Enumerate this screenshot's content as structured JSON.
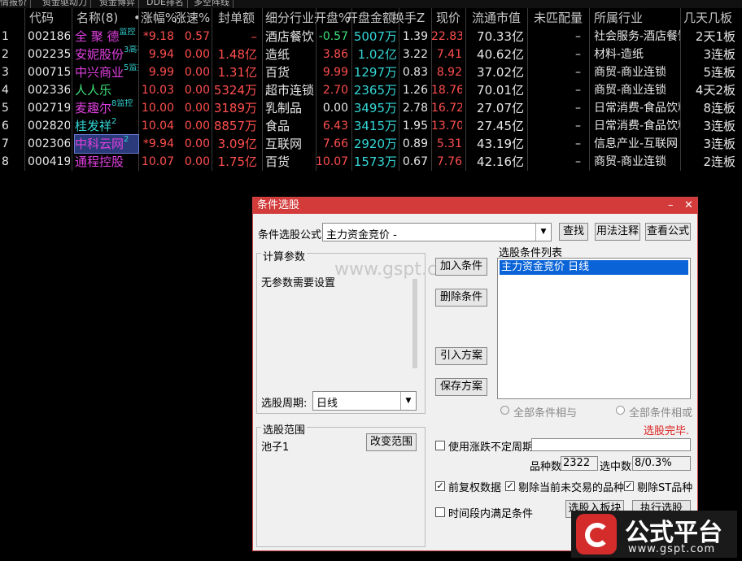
{
  "top_tabs": [
    "情报价",
    "资金驱动力",
    "资金博弈",
    "DDE排名",
    "多空阵线"
  ],
  "columns": [
    "代码",
    "名称(8)",
    "•涨幅%",
    "涨速%",
    "封单额",
    "细分行业",
    "开盘%",
    "开盘金额",
    "换手Z",
    "现价",
    "流通市值",
    "未匹配量",
    "所属行业",
    "几天几板"
  ],
  "rows": [
    {
      "idx": "1",
      "code": "002186",
      "name": "全 聚 德",
      "tag": "监控",
      "pct": "*9.18",
      "speed": "0.57",
      "seal": "–",
      "subind": "酒店餐饮",
      "open_pct": "-0.57",
      "open_amt": "5007万",
      "turnover": "1.39",
      "price": "22.83",
      "mcap": "70.33亿",
      "unmatched": "–",
      "industry": "社会服务-酒店餐饮",
      "boards": "2天1板"
    },
    {
      "idx": "2",
      "code": "002235",
      "name": "安妮股份",
      "tag": "3高视",
      "pct": "9.94",
      "speed": "0.00",
      "seal": "1.48亿",
      "subind": "造纸",
      "open_pct": "3.86",
      "open_amt": "1.02亿",
      "turnover": "3.22",
      "price": "7.41",
      "mcap": "40.62亿",
      "unmatched": "–",
      "industry": "材料-造纸",
      "boards": "3连板"
    },
    {
      "idx": "3",
      "code": "000715",
      "name": "中兴商业",
      "tag": "5监控",
      "pct": "9.99",
      "speed": "0.00",
      "seal": "1.31亿",
      "subind": "百货",
      "open_pct": "9.99",
      "open_amt": "1297万",
      "turnover": "0.83",
      "price": "8.92",
      "mcap": "37.02亿",
      "unmatched": "–",
      "industry": "商贸-商业连锁",
      "boards": "5连板"
    },
    {
      "idx": "4",
      "code": "002336",
      "name": "人人乐",
      "tag": "",
      "pct": "10.03",
      "speed": "0.00",
      "seal": "5324万",
      "subind": "超市连锁",
      "open_pct": "2.70",
      "open_amt": "2365万",
      "turnover": "1.26",
      "price": "18.76",
      "mcap": "70.01亿",
      "unmatched": "–",
      "industry": "商贸-商业连锁",
      "boards": "4天2板"
    },
    {
      "idx": "5",
      "code": "002719",
      "name": "麦趣尔",
      "tag": "8监控",
      "pct": "10.00",
      "speed": "0.00",
      "seal": "3189万",
      "subind": "乳制品",
      "open_pct": "0.00",
      "open_amt": "3495万",
      "turnover": "2.78",
      "price": "16.72",
      "mcap": "27.07亿",
      "unmatched": "–",
      "industry": "日常消费-食品饮料",
      "boards": "8连板"
    },
    {
      "idx": "6",
      "code": "002820",
      "name": "桂发祥",
      "tag": "2",
      "pct": "10.04",
      "speed": "0.00",
      "seal": "8857万",
      "subind": "食品",
      "open_pct": "6.43",
      "open_amt": "3415万",
      "turnover": "1.95",
      "price": "13.70",
      "mcap": "27.45亿",
      "unmatched": "–",
      "industry": "日常消费-食品饮料",
      "boards": "3连板"
    },
    {
      "idx": "7",
      "code": "002306",
      "name": "中科云网",
      "tag": "2",
      "pct": "*9.94",
      "speed": "0.00",
      "seal": "3.09亿",
      "subind": "互联网",
      "open_pct": "7.66",
      "open_amt": "2920万",
      "turnover": "0.89",
      "price": "5.31",
      "mcap": "43.19亿",
      "unmatched": "–",
      "industry": "信息产业-互联网",
      "boards": "3连板"
    },
    {
      "idx": "8",
      "code": "000419",
      "name": "通程控股",
      "tag": "",
      "pct": "10.07",
      "speed": "0.00",
      "seal": "1.75亿",
      "subind": "百货",
      "open_pct": "10.07",
      "open_amt": "1573万",
      "turnover": "0.67",
      "price": "7.76",
      "mcap": "42.16亿",
      "unmatched": "–",
      "industry": "商贸-商业连锁",
      "boards": "2连板"
    }
  ],
  "dialog": {
    "title": "条件选股",
    "formula_label": "条件选股公式",
    "formula_value": "主力资金竞价 -",
    "btn_find": "查找",
    "btn_usage": "用法注释",
    "btn_view": "查看公式",
    "params_title": "计算参数",
    "params_text": "无参数需要设置",
    "watermark": "www.gspt.com",
    "btn_add": "加入条件",
    "btn_delete": "删除条件",
    "btn_import": "引入方案",
    "btn_save": "保存方案",
    "list_title": "选股条件列表",
    "list_item": "主力资金竞价  日线",
    "period_label": "选股周期:",
    "period_value": "日线",
    "radio_and": "全部条件相与",
    "radio_or": "全部条件相或",
    "status": "选股完毕.",
    "scope_title": "选股范围",
    "scope_value": "池子1",
    "btn_scope": "改变范围",
    "use_period": "使用涨跌不定周期",
    "count_label": "品种数",
    "count_value": "2322",
    "hit_label": "选中数",
    "hit_value": "8/0.3%",
    "cb_rights": "前复权数据",
    "cb_notrade": "剔除当前未交易的品种",
    "cb_st": "剔除ST品种",
    "cb_timerange": "时间段内满足条件",
    "btn_to_board": "选股入板块",
    "btn_run": "执行选股"
  },
  "logo": {
    "text": "公式平台",
    "url_text": "www.gspt.com",
    "accent": "#d42b2b"
  }
}
